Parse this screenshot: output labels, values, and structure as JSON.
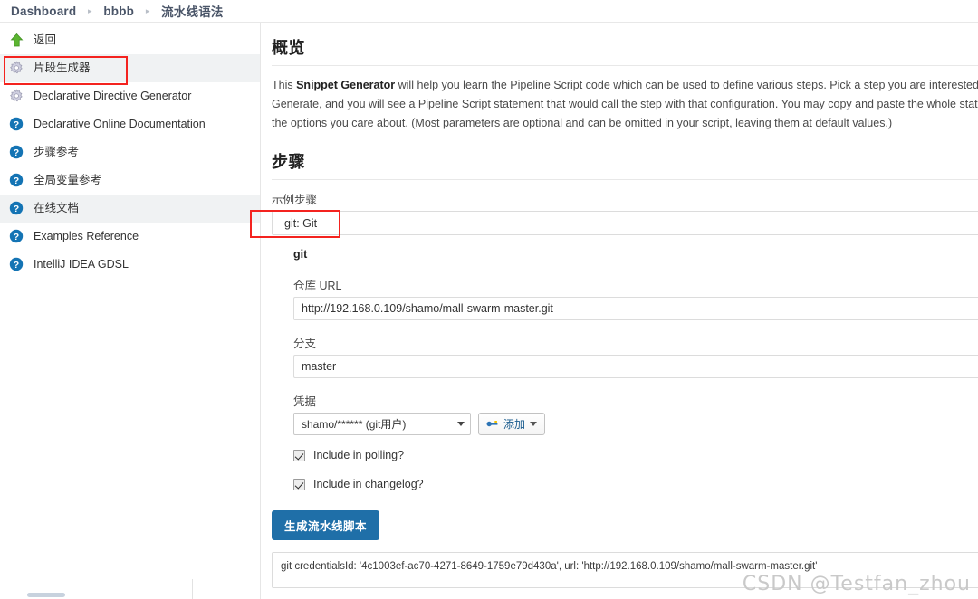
{
  "breadcrumb": {
    "items": [
      "Dashboard",
      "bbbb",
      "流水线语法"
    ],
    "separator": "▸"
  },
  "sidebar": {
    "items": [
      {
        "label": "返回",
        "icon": "up-arrow-icon",
        "selected": false
      },
      {
        "label": "片段生成器",
        "icon": "gear-icon",
        "selected": true
      },
      {
        "label": "Declarative Directive Generator",
        "icon": "gear-icon",
        "selected": false
      },
      {
        "label": "Declarative Online Documentation",
        "icon": "help-icon",
        "selected": false
      },
      {
        "label": "步骤参考",
        "icon": "help-icon",
        "selected": false
      },
      {
        "label": "全局变量参考",
        "icon": "help-icon",
        "selected": false
      },
      {
        "label": "在线文档",
        "icon": "help-icon",
        "selected": true
      },
      {
        "label": "Examples Reference",
        "icon": "help-icon",
        "selected": false
      },
      {
        "label": "IntelliJ IDEA GDSL",
        "icon": "help-icon",
        "selected": false
      }
    ]
  },
  "main": {
    "overview_heading": "概览",
    "overview_text_1": "This ",
    "overview_bold": "Snippet Generator",
    "overview_text_2": " will help you learn the Pipeline Script code which can be used to define various steps. Pick a step you are interested in from the list, configure it, click Generate, and you will see a Pipeline Script statement that would call the step with that configuration. You may copy and paste the whole statement into your script, or pick up just the options you care about. (Most parameters are optional and can be omitted in your script, leaving them at default values.)",
    "steps_heading": "步骤",
    "sample_step_label": "示例步骤",
    "sample_step_value": "git: Git",
    "step_name": "git",
    "repo_url_label": "仓库 URL",
    "repo_url_value": "http://192.168.0.109/shamo/mall-swarm-master.git",
    "branch_label": "分支",
    "branch_value": "master",
    "credentials_label": "凭据",
    "credentials_value": "shamo/****** (git用户)",
    "add_button_label": "添加",
    "checkbox_polling": "Include in polling?",
    "checkbox_changelog": "Include in changelog?",
    "generate_button": "生成流水线脚本",
    "output_code": "git credentialsId: '4c1003ef-ac70-4271-8649-1759e79d430a', url: 'http://192.168.0.109/shamo/mall-swarm-master.git'"
  },
  "watermark": "CSDN @Testfan_zhou",
  "colors": {
    "accent_blue": "#1f6fa8",
    "annotation_red": "#f4231f",
    "selected_row": "#f0f2f3",
    "help_icon": "#1474b4",
    "up_arrow": "#5cb531"
  }
}
